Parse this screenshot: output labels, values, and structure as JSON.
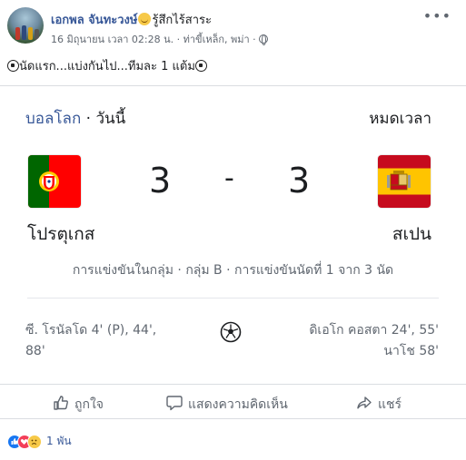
{
  "post": {
    "author": "เอกพล จันทะวงษ์",
    "feeling": "รู้สึกไร้สาระ",
    "timestamp": "16 มิถุนายน เวลา 02:28 น.",
    "location": "· ท่าขี้เหล็ก, พม่า ·",
    "more_label": "•••",
    "text": "นัดแรก...แบ่งกันไป...ทีมละ 1 แต้ม"
  },
  "match": {
    "league": "บอลโลก",
    "separator": " · ",
    "date": "วันนี้",
    "status": "หมดเวลา",
    "home_team": "โปรตุเกส",
    "away_team": "สเปน",
    "home_score": "3",
    "dash": "-",
    "away_score": "3",
    "info": "การแข่งขันในกลุ่ม · กลุ่ม B · การแข่งขันนัดที่ 1 จาก 3 นัด",
    "home_scorers": [
      "ซี. โรนัลโด 4' (P), 44',",
      "88'"
    ],
    "away_scorers": [
      "ดิเอโก คอสตา 24', 55'",
      "นาโช 58'"
    ]
  },
  "actions": {
    "like": "ถูกใจ",
    "comment": "แสดงความคิดเห็น",
    "share": "แชร์"
  },
  "reactions": {
    "icons": [
      "like-icon",
      "love-icon",
      "sad-icon"
    ],
    "count": "1 พัน"
  },
  "colors": {
    "link": "#385898",
    "secondary_text": "#606770",
    "divider": "#dadde1"
  }
}
